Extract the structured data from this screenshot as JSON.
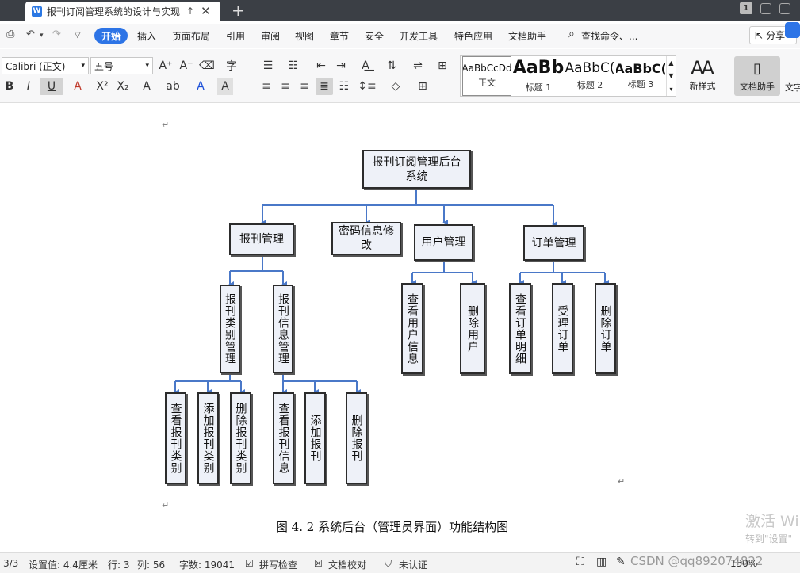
{
  "tab": {
    "title": "报刊订阅管理系统的设计与实现",
    "page_badge": "1"
  },
  "menu": {
    "items": [
      "开始",
      "插入",
      "页面布局",
      "引用",
      "审阅",
      "视图",
      "章节",
      "安全",
      "开发工具",
      "特色应用",
      "文档助手",
      "查找命令、..."
    ],
    "share": "分享"
  },
  "ribbon": {
    "font_name": "Calibri (正文)",
    "font_size": "五号",
    "styles": [
      {
        "sample": "AaBbCcDd",
        "name": "正文"
      },
      {
        "sample": "AaBb",
        "name": "标题 1"
      },
      {
        "sample": "AaBbC(",
        "name": "标题 2"
      },
      {
        "sample": "AaBbC(",
        "name": "标题 3"
      }
    ],
    "new_style": "新样式",
    "doc_helper": "文档助手",
    "text_tool": "文字"
  },
  "diagram": {
    "root": "报刊订阅管理后台系统",
    "nodes": {
      "n1": "报刊管理",
      "n2": "密码信息修改",
      "n3": "用户管理",
      "n4": "订单管理",
      "n1a": "报刊类别管理",
      "n1b": "报刊信息管理",
      "n1a1": "查看报刊类别",
      "n1a2": "添加报刊类别",
      "n1a3": "删除报刊类别",
      "n1b1": "查看报刊信息",
      "n1b2": "添加报刊",
      "n1b3": "删除报刊",
      "n3a": "查看用户信息",
      "n3b": "删除用户",
      "n4a": "查看订单明细",
      "n4b": "受理订单",
      "n4c": "删除订单"
    },
    "caption": "图 4. 2 系统后台（管理员界面）功能结构图"
  },
  "watermark": {
    "line1": "激活 Wi",
    "line2": "转到\"设置\""
  },
  "status": {
    "page": "3/3",
    "setting": "设置值: 4.4厘米",
    "row": "行: 3",
    "col": "列: 56",
    "words": "字数: 19041",
    "spell": "拼写检查",
    "proof": "文档校对",
    "auth": "未认证",
    "zoom": "130%",
    "csdn": "CSDN @qq892074822"
  },
  "colors": {
    "accent": "#2d74e6",
    "connector": "#4a78c8",
    "node_fill": "#eef1f8"
  }
}
